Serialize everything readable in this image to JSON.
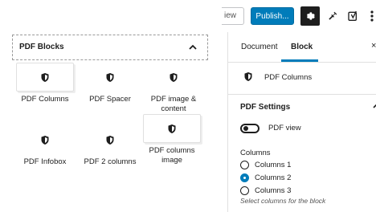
{
  "toolbar": {
    "preview_label": "iew",
    "publish_label": "Publish...",
    "accent": "#007cba"
  },
  "blocks_panel": {
    "title": "PDF Blocks",
    "items": [
      {
        "label": "PDF Columns",
        "icon": "shield-icon"
      },
      {
        "label": "PDF Spacer",
        "icon": "shield-icon"
      },
      {
        "label": "PDF image &\ncontent",
        "icon": "shield-icon"
      },
      {
        "label": "PDF Infobox",
        "icon": "shield-icon"
      },
      {
        "label": "PDF 2 columns",
        "icon": "shield-icon"
      },
      {
        "label": "PDF columns\nimage",
        "icon": "shield-icon"
      }
    ]
  },
  "sidebar": {
    "tabs": {
      "document": "Document",
      "block": "Block"
    },
    "block_card_title": "PDF Columns",
    "settings_title": "PDF Settings",
    "toggle_label": "PDF view",
    "columns_label": "Columns",
    "options": [
      "Columns 1",
      "Columns 2",
      "Columns 3"
    ],
    "selected_option": "Columns 2",
    "help_text": "Select columns for the block"
  }
}
